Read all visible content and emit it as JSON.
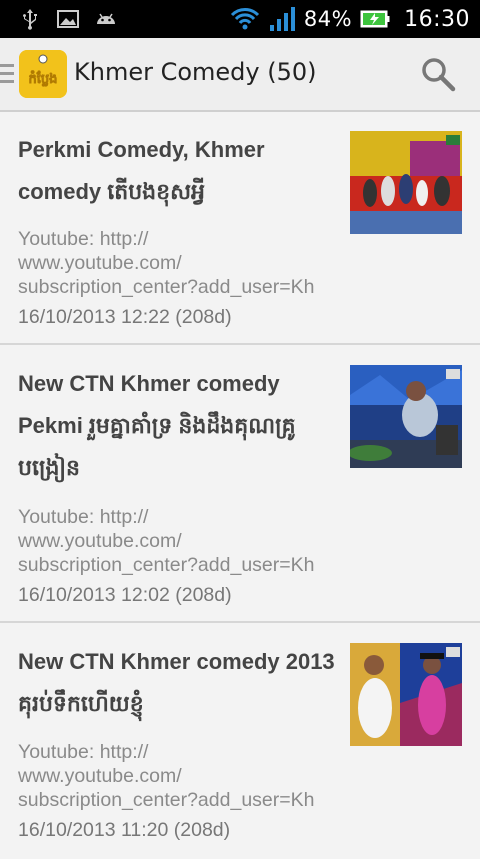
{
  "status_bar": {
    "battery_percent": "84%",
    "time": "16:30",
    "icons": [
      "usb-icon",
      "image-icon",
      "android-icon",
      "wifi-icon",
      "signal-icon",
      "battery-charging-icon"
    ]
  },
  "action_bar": {
    "title": "Khmer Comedy (50)",
    "logo_text": "កំប្លែង",
    "icons": [
      "drawer-icon",
      "search-icon"
    ]
  },
  "items": [
    {
      "title": "Perkmi Comedy, Khmer comedy តើបងខុសអ្វី",
      "desc": "Youtube: http://\nwww.youtube.com/\nsubscription_center?add_user=Kh",
      "date": "16/10/2013 12:22 (208d)"
    },
    {
      "title": "New CTN Khmer comedy Pekmi រួមគ្នាគាំទ្រ និងដឹងគុណគ្រូបង្រៀន",
      "desc": "Youtube: http://\nwww.youtube.com/\nsubscription_center?add_user=Kh",
      "date": "16/10/2013 12:02 (208d)"
    },
    {
      "title": "New CTN Khmer comedy 2013 គុរប់ទឹកហើយខ្ញុំ",
      "desc": "Youtube: http://\nwww.youtube.com/\nsubscription_center?add_user=Kh",
      "date": "16/10/2013 11:20 (208d)"
    }
  ],
  "colors": {
    "status_bar_bg": "#000000",
    "action_bar_bg": "#eeeeee",
    "list_bg": "#f3f3f3",
    "logo_bg": "#f2c21b",
    "battery_green": "#3ec43e"
  }
}
